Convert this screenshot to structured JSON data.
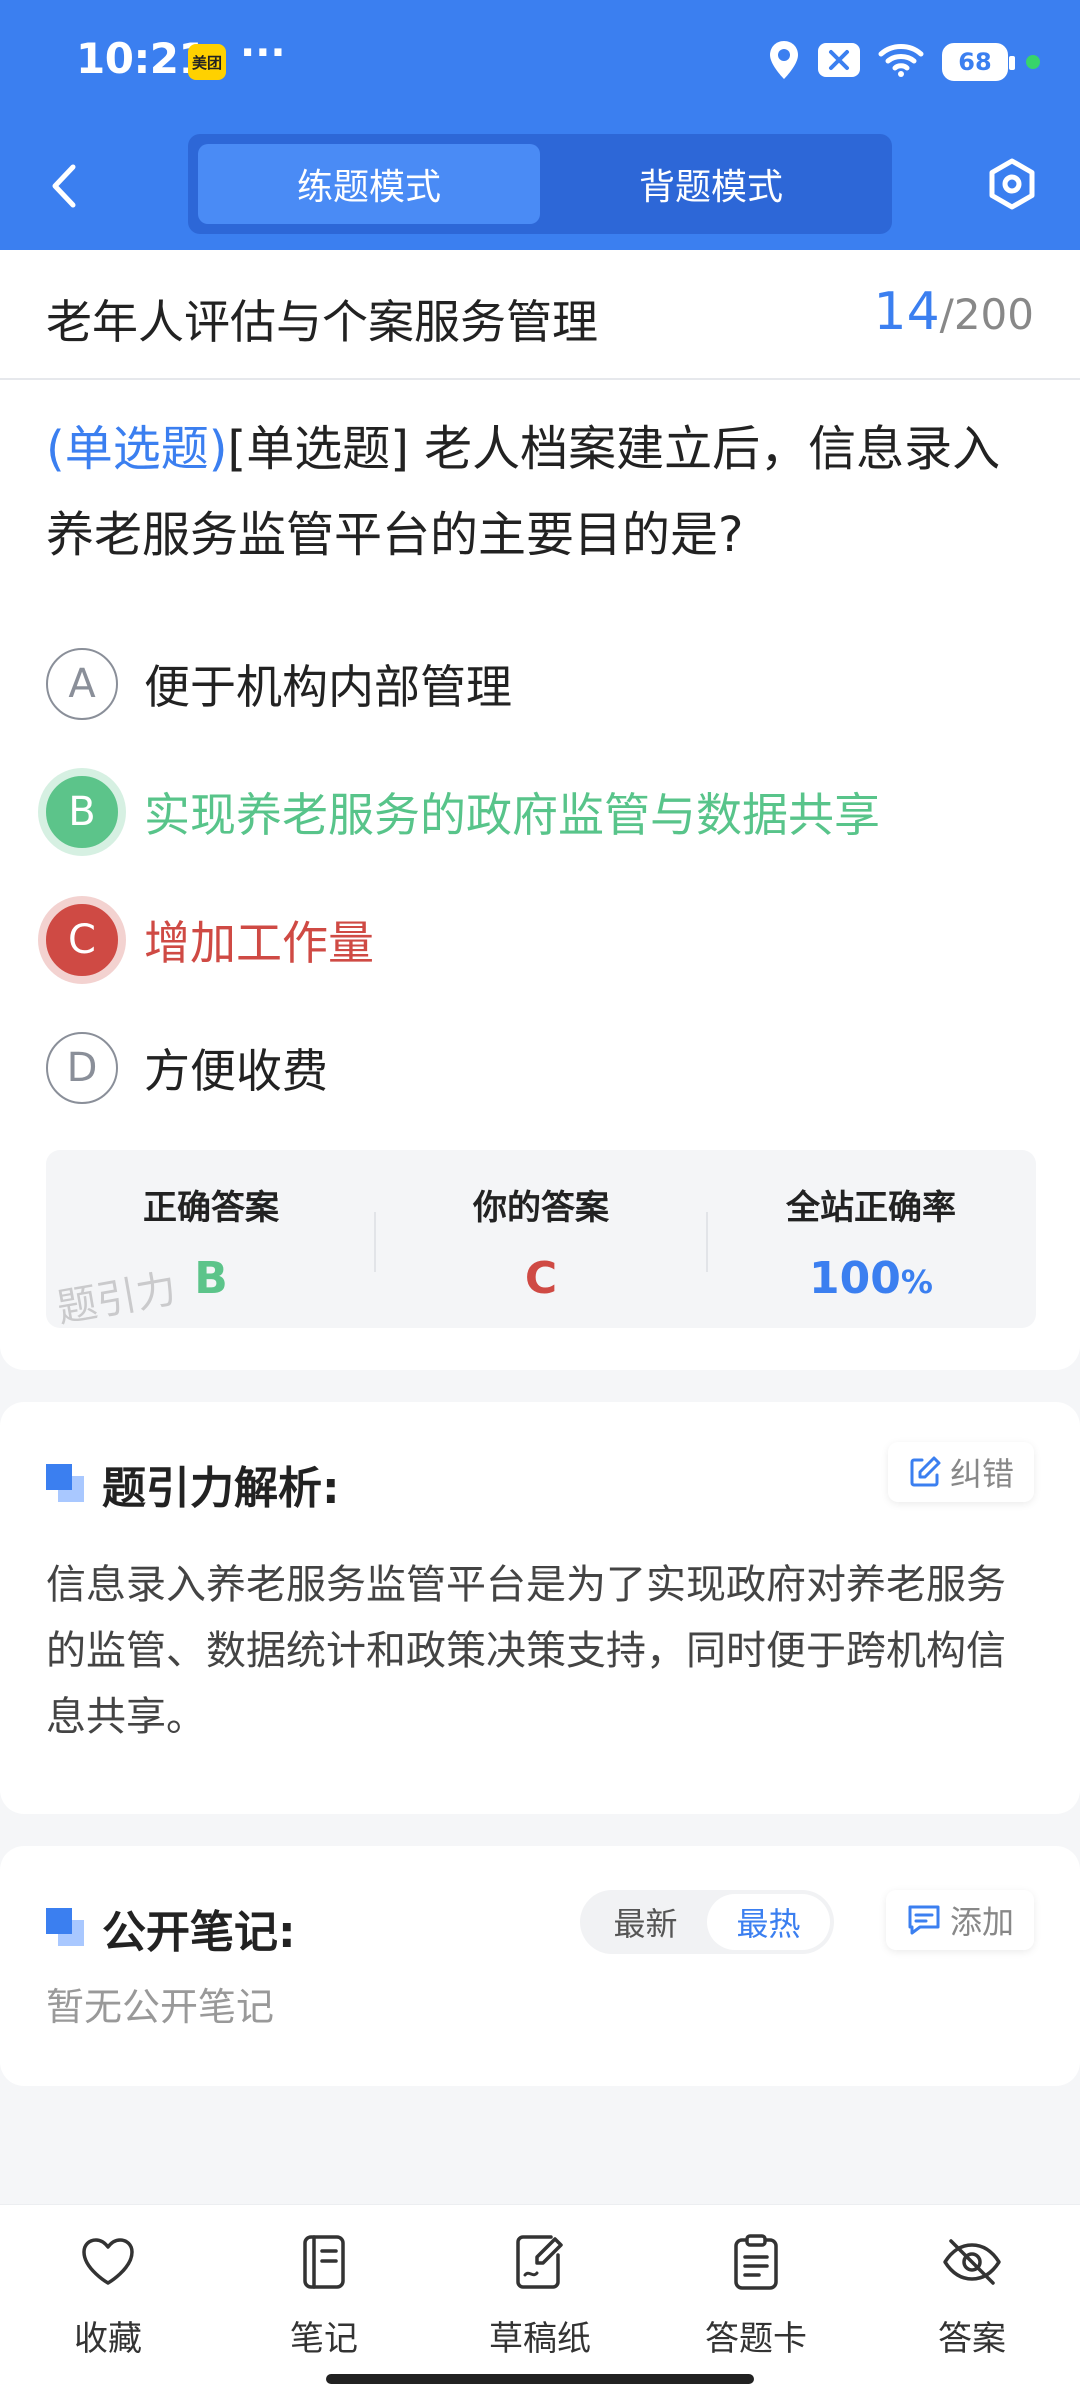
{
  "status_bar": {
    "time": "10:21",
    "app_badge": "美团",
    "dots": "···",
    "battery": "68"
  },
  "nav": {
    "modes": [
      "练题模式",
      "背题模式"
    ],
    "active_mode_index": 0
  },
  "title_bar": {
    "title": "老年人评估与个案服务管理",
    "current": "14",
    "sep": "/",
    "total": "200"
  },
  "question": {
    "type_tag": "(单选题)",
    "text": "[单选题] 老人档案建立后，信息录入养老服务监管平台的主要目的是?"
  },
  "options": [
    {
      "letter": "A",
      "text": "便于机构内部管理",
      "state": "normal"
    },
    {
      "letter": "B",
      "text": "实现养老服务的政府监管与数据共享",
      "state": "correct"
    },
    {
      "letter": "C",
      "text": "增加工作量",
      "state": "wrong"
    },
    {
      "letter": "D",
      "text": "方便收费",
      "state": "normal"
    }
  ],
  "answer_summary": {
    "correct_label": "正确答案",
    "correct_value": "B",
    "yours_label": "你的答案",
    "yours_value": "C",
    "rate_label": "全站正确率",
    "rate_value": "100",
    "rate_unit": "%",
    "watermark": "题引力"
  },
  "analysis": {
    "title": "题引力解析:",
    "report_label": "纠错",
    "body": "信息录入养老服务监管平台是为了实现政府对养老服务的监管、数据统计和政策决策支持，同时便于跨机构信息共享。"
  },
  "notes": {
    "title": "公开笔记:",
    "sort_options": [
      "最新",
      "最热"
    ],
    "active_sort_index": 1,
    "add_label": "添加",
    "empty_text": "暂无公开笔记"
  },
  "bottom_nav": [
    {
      "label": "收藏",
      "icon": "heart-icon"
    },
    {
      "label": "笔记",
      "icon": "notebook-icon"
    },
    {
      "label": "草稿纸",
      "icon": "draft-paper-icon"
    },
    {
      "label": "答题卡",
      "icon": "answer-card-icon"
    },
    {
      "label": "答案",
      "icon": "eye-off-icon"
    }
  ],
  "colors": {
    "primary": "#3b7ff0",
    "correct": "#5cc48a",
    "wrong": "#cf4a44"
  }
}
